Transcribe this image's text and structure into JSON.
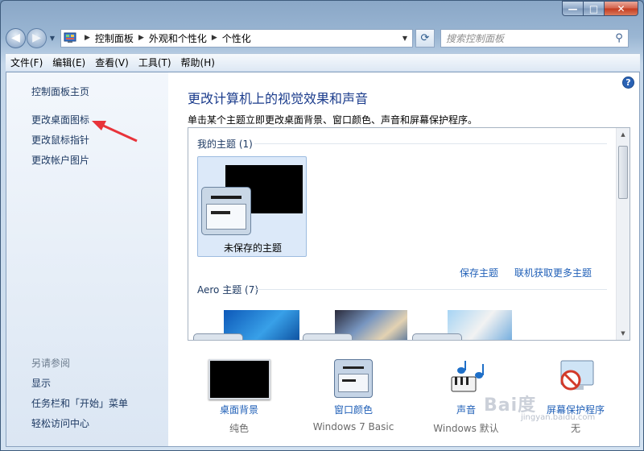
{
  "window": {
    "caption_min": "—",
    "caption_max": "□",
    "caption_close": "✕"
  },
  "nav": {
    "back_glyph": "◀",
    "forward_glyph": "▶",
    "breadcrumbs": [
      "控制面板",
      "外观和个性化",
      "个性化"
    ],
    "search_placeholder": "搜索控制面板"
  },
  "menu": [
    "文件(F)",
    "编辑(E)",
    "查看(V)",
    "工具(T)",
    "帮助(H)"
  ],
  "sidebar": {
    "links": [
      "控制面板主页",
      "更改桌面图标",
      "更改鼠标指针",
      "更改帐户图片"
    ],
    "see_also_heading": "另请参阅",
    "see_also": [
      "显示",
      "任务栏和「开始」菜单",
      "轻松访问中心"
    ]
  },
  "main": {
    "title": "更改计算机上的视觉效果和声音",
    "description": "单击某个主题立即更改桌面背景、窗口颜色、声音和屏幕保护程序。",
    "my_themes_title": "我的主题 (1)",
    "unsaved_theme_label": "未保存的主题",
    "save_theme_link": "保存主题",
    "get_more_link": "联机获取更多主题",
    "aero_themes_title": "Aero 主题 (7)"
  },
  "bottom": [
    {
      "link": "桌面背景",
      "sub": "纯色",
      "icon": "desktop-background-icon"
    },
    {
      "link": "窗口颜色",
      "sub": "Windows 7 Basic",
      "icon": "window-color-icon"
    },
    {
      "link": "声音",
      "sub": "Windows 默认",
      "icon": "sound-icon"
    },
    {
      "link": "屏幕保护程序",
      "sub": "无",
      "icon": "screensaver-icon"
    }
  ],
  "watermark": {
    "text": "Bai度",
    "sub": "jingyan.baidu.com"
  },
  "colors": {
    "link": "#1f5fb7",
    "title": "#1b3c8c",
    "annotation_arrow": "#e8333a"
  }
}
